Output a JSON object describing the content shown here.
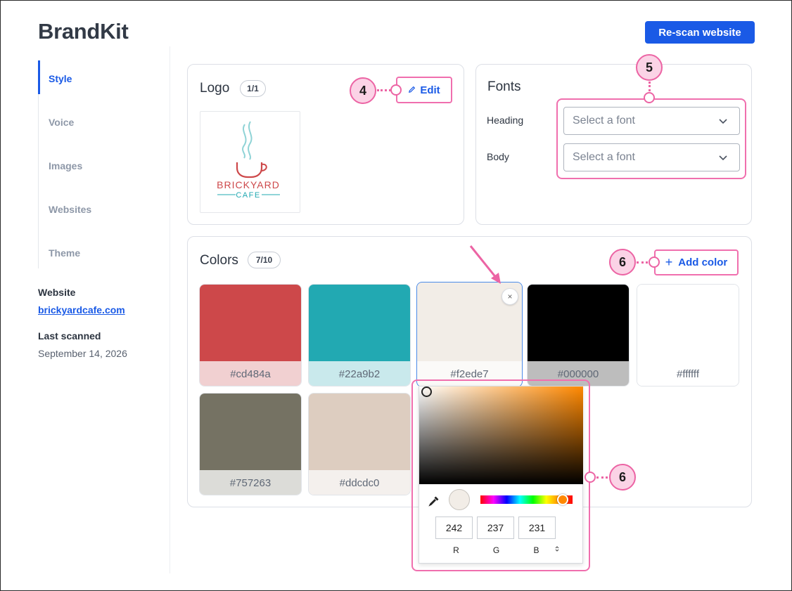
{
  "header": {
    "title": "BrandKit",
    "rescan_label": "Re-scan website"
  },
  "nav": {
    "items": [
      {
        "label": "Style",
        "active": true
      },
      {
        "label": "Voice",
        "active": false
      },
      {
        "label": "Images",
        "active": false
      },
      {
        "label": "Websites",
        "active": false
      },
      {
        "label": "Theme",
        "active": false
      }
    ]
  },
  "site_meta": {
    "website_label": "Website",
    "website_url": "brickyardcafe.com",
    "last_scanned_label": "Last scanned",
    "last_scanned_value": "September 14, 2026"
  },
  "logo_card": {
    "title": "Logo",
    "count": "1/1",
    "edit_label": "Edit",
    "logo_text_main": "BRICKYARD",
    "logo_text_sub": "CAFE"
  },
  "fonts_card": {
    "title": "Fonts",
    "heading_label": "Heading",
    "body_label": "Body",
    "heading_placeholder": "Select a font",
    "body_placeholder": "Select a font"
  },
  "colors_card": {
    "title": "Colors",
    "count": "7/10",
    "add_label": "Add color",
    "remove_symbol": "×",
    "swatches": [
      {
        "hex": "#cd484a",
        "label": "#cd484a",
        "label_bg": "#f1d0d1"
      },
      {
        "hex": "#22a9b2",
        "label": "#22a9b2",
        "label_bg": "#c9e9ec"
      },
      {
        "hex": "#f2ede7",
        "label": "#f2ede7",
        "label_bg": "#fbfaf8"
      },
      {
        "hex": "#000000",
        "label": "#000000",
        "label_bg": "#bdbdbd"
      },
      {
        "hex": "#ffffff",
        "label": "#ffffff",
        "label_bg": "#ffffff"
      },
      {
        "hex": "#757263",
        "label": "#757263",
        "label_bg": "#dcdcd8"
      },
      {
        "hex": "#ddcdc0",
        "label": "#ddcdc0",
        "label_bg": "#f4f0ed"
      }
    ]
  },
  "color_picker": {
    "r": "242",
    "g": "237",
    "b": "231",
    "r_label": "R",
    "g_label": "G",
    "b_label": "B",
    "mode_toggle": "⌃⌄",
    "hue_color": "#ff8800",
    "preview_color": "#f2ede7"
  },
  "callouts": {
    "logo_edit": "4",
    "fonts": "5",
    "add_color": "6",
    "picker": "6"
  },
  "colors": {
    "accent": "#1a5ae6",
    "highlight": "#f06fae"
  }
}
